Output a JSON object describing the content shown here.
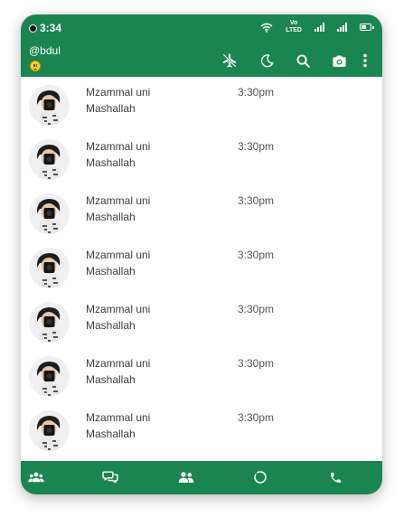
{
  "theme": {
    "primary": "#1a8550",
    "background": "#ffffff",
    "text": "#3d3d3d"
  },
  "status_bar": {
    "time": "3:34",
    "network_label_top": "Vo",
    "network_label_bottom": "LTED",
    "icons": [
      "camera-dot-icon",
      "wifi-icon",
      "volte-icon",
      "signal-icon",
      "signal-icon",
      "battery-icon"
    ]
  },
  "header": {
    "username": "@bdul",
    "status_emoji": "smiling-face-emoji",
    "actions": [
      "airplane-mode-off-icon",
      "dark-mode-moon-icon",
      "search-icon",
      "camera-icon",
      "more-vertical-icon"
    ]
  },
  "chats": [
    {
      "name": "Mzammal uni",
      "time": "3:30pm",
      "message": "Mashallah",
      "avatar": "user-avatar"
    },
    {
      "name": "Mzammal uni",
      "time": "3:30pm",
      "message": "Mashallah",
      "avatar": "user-avatar"
    },
    {
      "name": "Mzammal uni",
      "time": "3:30pm",
      "message": "Mashallah",
      "avatar": "user-avatar"
    },
    {
      "name": "Mzammal uni",
      "time": "3:30pm",
      "message": "Mashallah",
      "avatar": "user-avatar"
    },
    {
      "name": "Mzammal uni",
      "time": "3:30pm",
      "message": "Mashallah",
      "avatar": "user-avatar"
    },
    {
      "name": "Mzammal uni",
      "time": "3:30pm",
      "message": "Mashallah",
      "avatar": "user-avatar"
    },
    {
      "name": "Mzammal uni",
      "time": "3:30pm",
      "message": "Mashallah",
      "avatar": "user-avatar"
    }
  ],
  "bottom_nav": [
    "community-icon",
    "chats-icon",
    "contacts-icon",
    "status-icon",
    "calls-icon"
  ]
}
